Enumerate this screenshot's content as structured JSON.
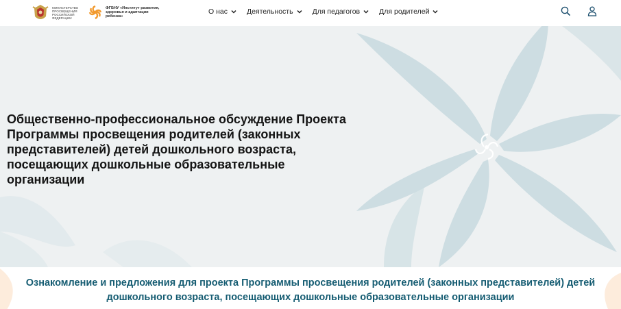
{
  "header": {
    "ministry_logo_text": "Министерство просвещения Российской Федерации",
    "institute_logo_text": "ФГБНУ «Институт развития, здоровья и адаптации ребенка»",
    "nav": [
      {
        "label": "О нас"
      },
      {
        "label": "Деятельность"
      },
      {
        "label": "Для педагогов"
      },
      {
        "label": "Для родителей"
      }
    ]
  },
  "hero": {
    "title": "Общественно-профессиональное обсуждение Проекта Программы просвещения родителей (законных представителей) детей дошкольного возраста, посещающих дошкольные образовательные организации"
  },
  "section": {
    "heading": "Ознакомление и предложения для проекта Программы просвещения родителей (законных представителей) детей дошкольного возраста, посещающих дошкольные образовательные организации"
  },
  "colors": {
    "hero_bg": "#eef1f2",
    "petals": "#c9dbe0",
    "heading_accent": "#155c72",
    "logo_orange": "#f29a2e"
  }
}
